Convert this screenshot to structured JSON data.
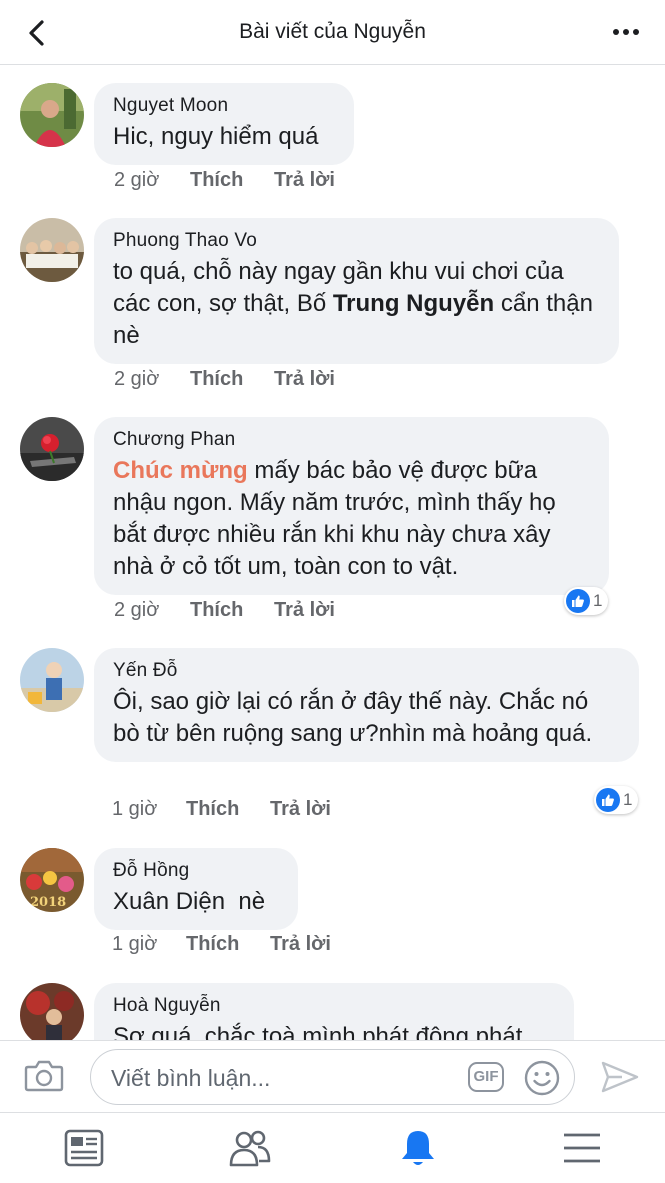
{
  "header": {
    "title": "Bài viết của Nguyễn"
  },
  "comments": [
    {
      "author": "Nguyet Moon",
      "text": "Hic, nguy hiểm quá",
      "time": "2 giờ",
      "like": "Thích",
      "reply": "Trả lời"
    },
    {
      "author": "Phuong Thao Vo",
      "text_pre": "to quá, chỗ này ngay gần khu vui chơi của các con, sợ thật, Bố ",
      "tag": "Trung Nguyễn",
      "text_post": " cẩn thận nè",
      "time": "2 giờ",
      "like": "Thích",
      "reply": "Trả lời"
    },
    {
      "author": "Chương Phan",
      "tag": "Chúc mừng",
      "text_post": " mấy bác bảo vệ được bữa nhậu ngon. Mấy năm trước, mình thấy họ bắt được nhiều rắn khi khu này chưa xây nhà ở cỏ tốt um, toàn con to vật.",
      "time": "2 giờ",
      "like": "Thích",
      "reply": "Trả lời",
      "reactions": "1"
    },
    {
      "author": "Yến Đỗ",
      "text": "Ôi, sao giờ lại có rắn ở đây thế này. Chắc nó bò từ bên ruộng sang ư?nhìn mà hoảng quá.",
      "time": "1 giờ",
      "like": "Thích",
      "reply": "Trả lời",
      "reactions": "1"
    },
    {
      "author": "Đỗ Hồng",
      "text": "Xuân Diện  nè",
      "time": "1 giờ",
      "like": "Thích",
      "reply": "Trả lời"
    },
    {
      "author": "Hoà Nguyễn",
      "text": "Sợ quá, chắc toà mình phát động phát"
    }
  ],
  "composer": {
    "placeholder": "Viết bình luận...",
    "gif_label": "GIF"
  },
  "tabs": [
    "news-feed-icon",
    "friends-icon",
    "notifications-icon",
    "menu-icon"
  ],
  "colors": {
    "accent": "#1877f2",
    "mention": "#e9775b",
    "bubble": "#f0f2f5"
  }
}
